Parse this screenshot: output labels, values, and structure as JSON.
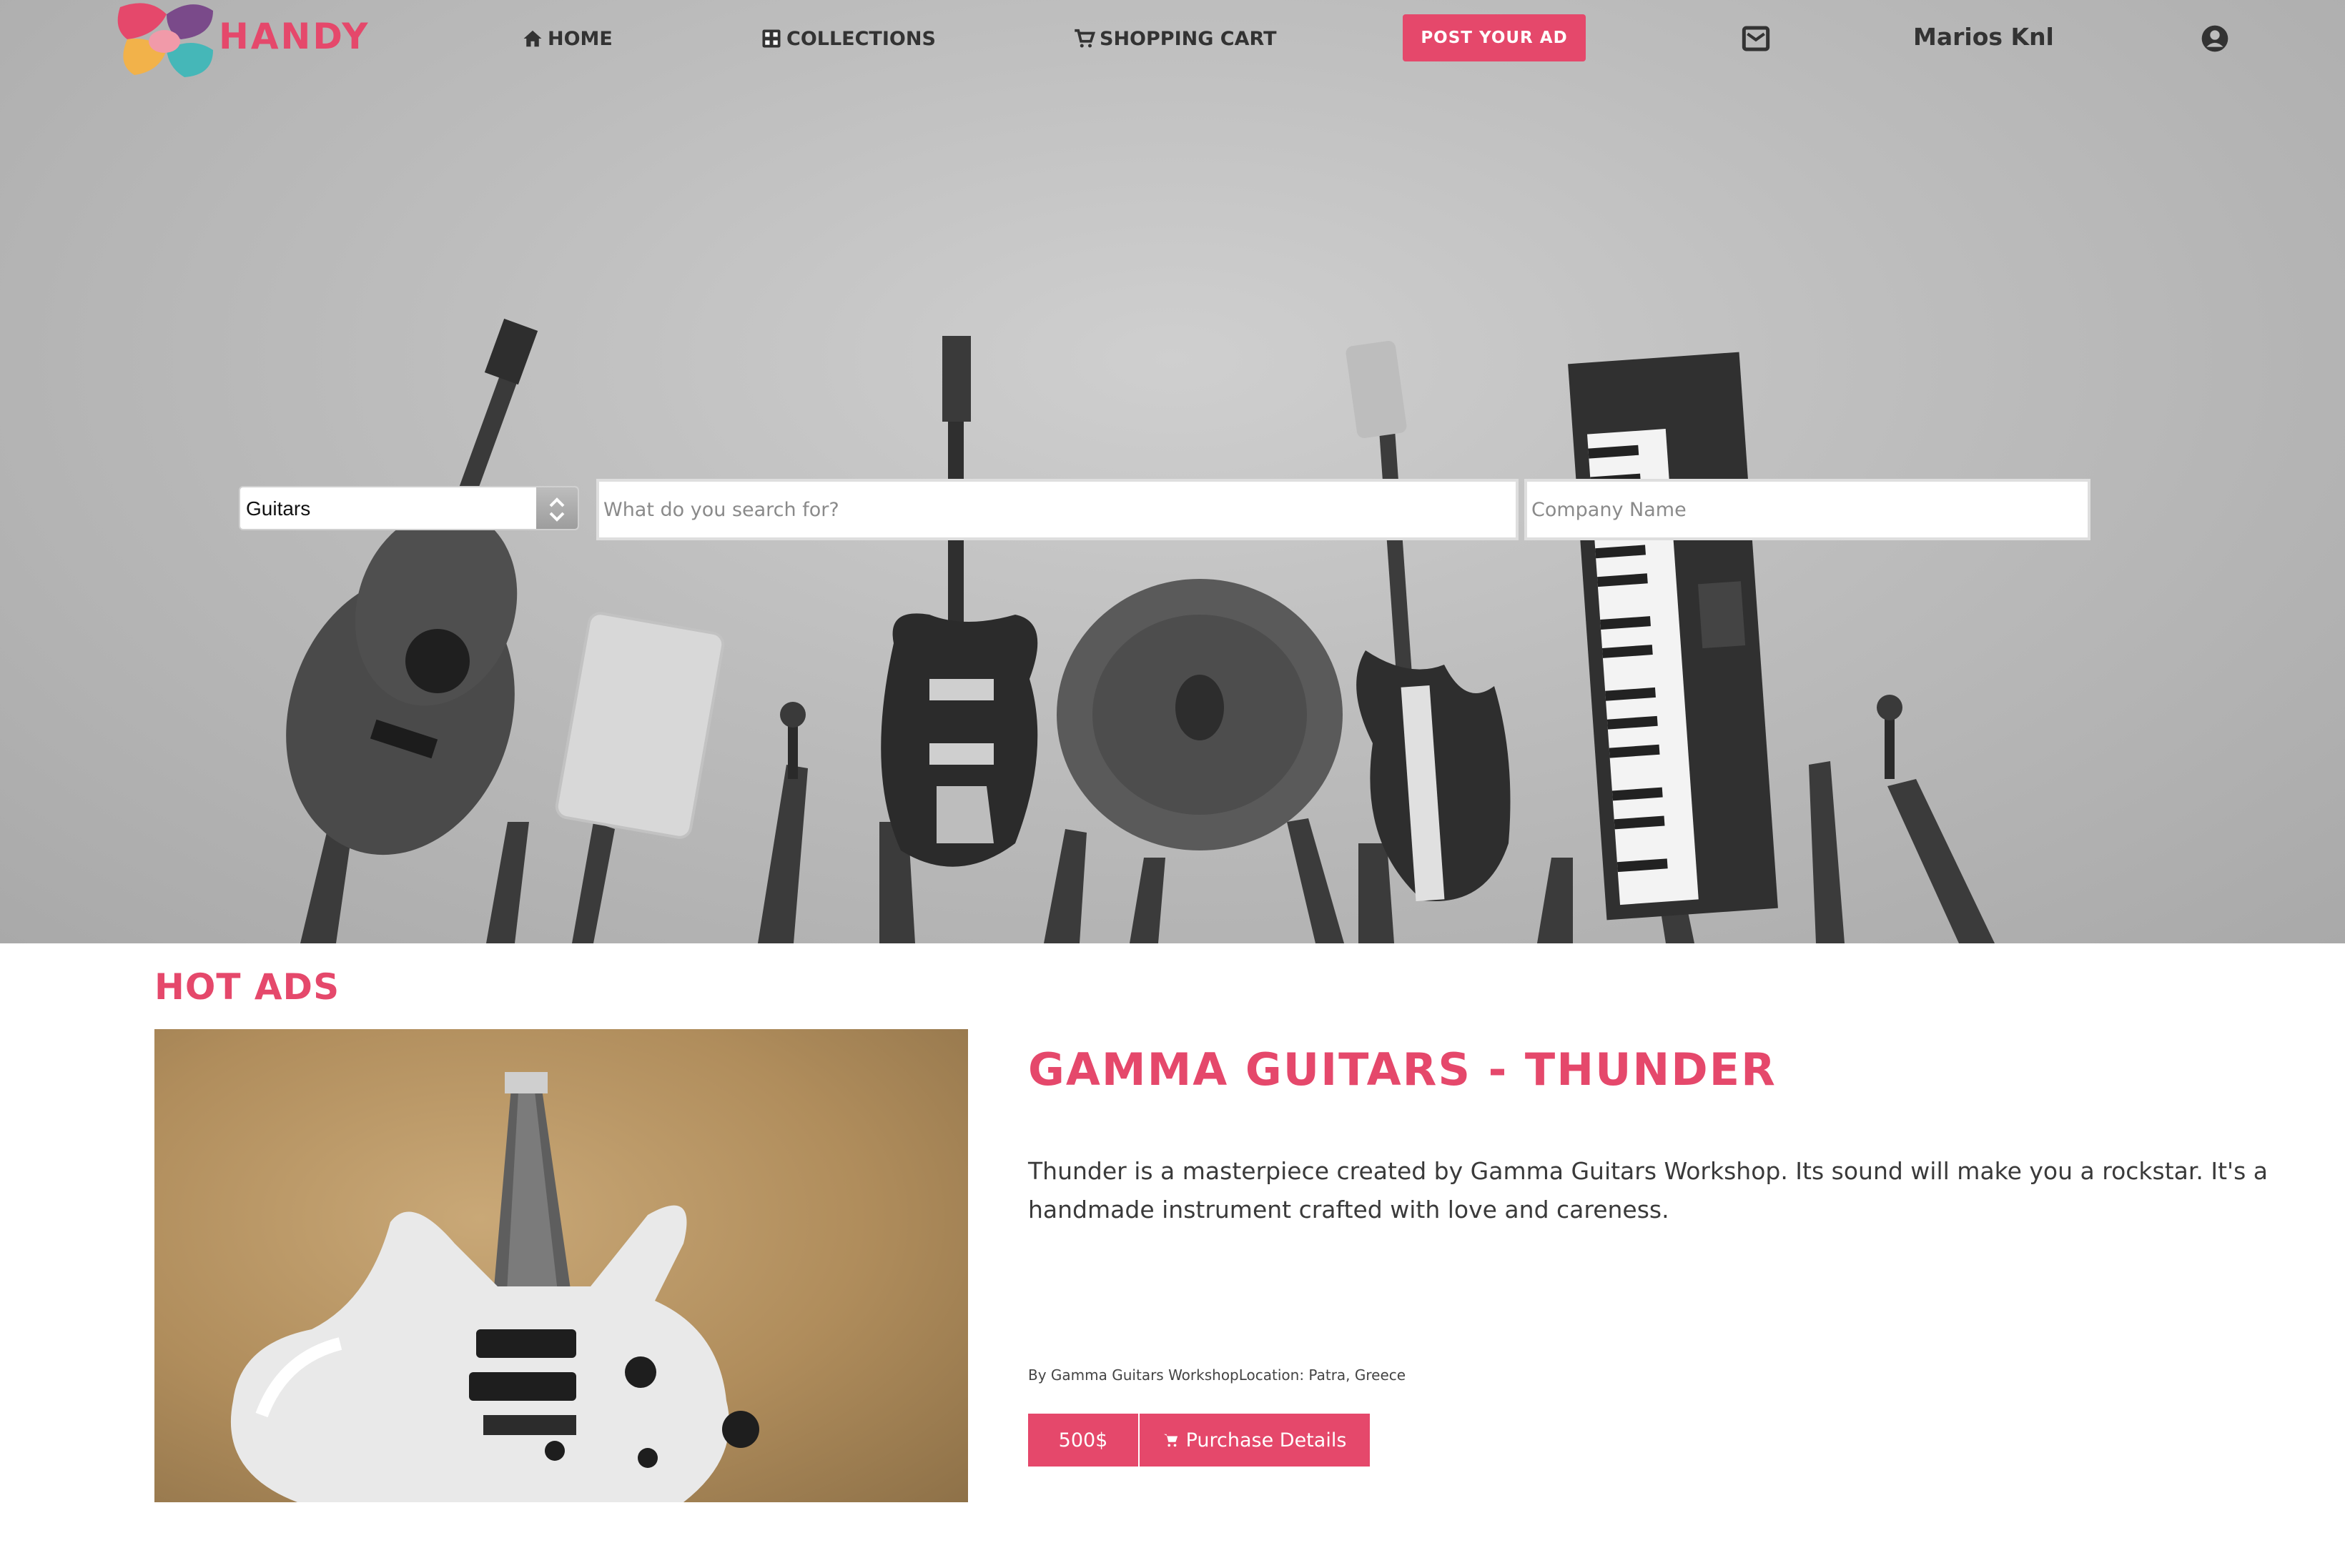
{
  "brand": {
    "name": "HANDY"
  },
  "nav": {
    "home": "HOME",
    "collections": "COLLECTIONS",
    "cart": "SHOPPING CART",
    "post_ad": "POST YOUR AD",
    "user_name": "Marios Knl",
    "icons": {
      "home": "home-icon",
      "collections": "grid-icon",
      "cart": "cart-icon",
      "mail": "envelope-icon",
      "profile": "user-circle-icon"
    }
  },
  "search": {
    "category_selected": "Guitars",
    "query_placeholder": "What do you search for?",
    "company_placeholder": "Company Name"
  },
  "hot_ads": {
    "title": "HOT ADS",
    "ad": {
      "title": "GAMMA GUITARS - THUNDER",
      "description": "Thunder is a masterpiece created by Gamma Guitars Workshop. Its sound will make you a rockstar. It's a handmade instrument crafted with love and careness.",
      "meta": "By Gamma Guitars WorkshopLocation: Patra, Greece",
      "price": "500$",
      "purchase_label": "Purchase Details"
    }
  },
  "colors": {
    "accent": "#e5486b",
    "text": "#3a3a3a"
  }
}
